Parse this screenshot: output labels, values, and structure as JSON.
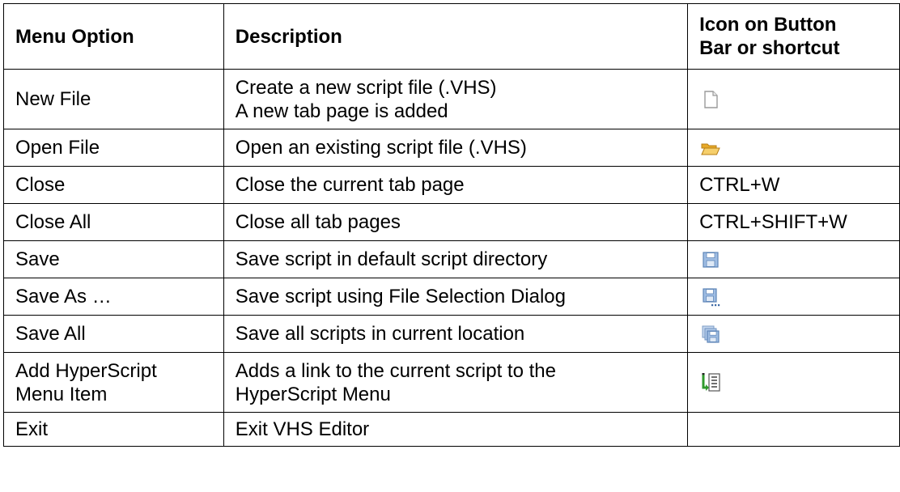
{
  "table": {
    "headers": {
      "option": "Menu Option",
      "description": "Description",
      "icon_line1": "Icon on Button",
      "icon_line2": "Bar or shortcut"
    },
    "rows": [
      {
        "option": "New File",
        "description_line1": "Create a new script file (.VHS)",
        "description_line2": "A new tab page is added",
        "icon": "new-file-icon"
      },
      {
        "option": "Open File",
        "description_line1": "Open an existing script file (.VHS)",
        "icon": "open-folder-icon"
      },
      {
        "option": "Close",
        "description_line1": "Close the current tab page",
        "shortcut": "CTRL+W"
      },
      {
        "option": "Close All",
        "description_line1": "Close all tab pages",
        "shortcut": "CTRL+SHIFT+W"
      },
      {
        "option": "Save",
        "description_line1": "Save script in default script directory",
        "icon": "save-icon"
      },
      {
        "option": "Save As …",
        "description_line1": "Save script using File Selection Dialog",
        "icon": "save-as-icon"
      },
      {
        "option": "Save All",
        "description_line1": "Save all scripts in current location",
        "icon": "save-all-icon"
      },
      {
        "option_line1": "Add HyperScript",
        "option_line2": "Menu Item",
        "description_line1": "Adds a link to the current script to the",
        "description_line2": "HyperScript Menu",
        "icon": "add-hyperscript-icon"
      },
      {
        "option": "Exit",
        "description_line1": "Exit VHS Editor"
      }
    ]
  },
  "colors": {
    "border": "#000000",
    "folder": "#f2c24a",
    "save_blue": "#7ea6d6",
    "hyperscript_green": "#3aa335"
  }
}
